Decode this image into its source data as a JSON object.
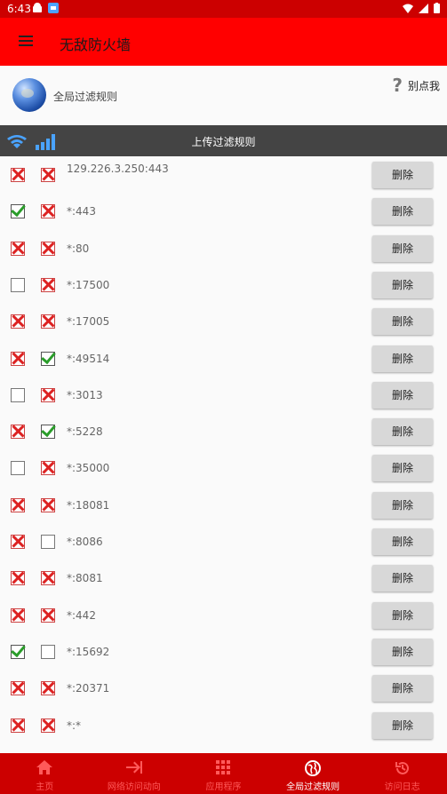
{
  "status": {
    "time": "6:43"
  },
  "app": {
    "title": "无敌防火墙"
  },
  "header": {
    "title": "全局过滤规则",
    "help_label": "别点我"
  },
  "toolbar": {
    "upload_label": "上传过滤规则"
  },
  "rules": [
    {
      "addr": "129.226.3.250:443",
      "c1": "x",
      "c2": "x"
    },
    {
      "addr": "*:443",
      "c1": "ok",
      "c2": "x"
    },
    {
      "addr": "*:80",
      "c1": "x",
      "c2": "x"
    },
    {
      "addr": "*:17500",
      "c1": "empty",
      "c2": "x"
    },
    {
      "addr": "*:17005",
      "c1": "x",
      "c2": "x"
    },
    {
      "addr": "*:49514",
      "c1": "x",
      "c2": "ok"
    },
    {
      "addr": "*:3013",
      "c1": "empty",
      "c2": "x"
    },
    {
      "addr": "*:5228",
      "c1": "x",
      "c2": "ok"
    },
    {
      "addr": "*:35000",
      "c1": "empty",
      "c2": "x"
    },
    {
      "addr": "*:18081",
      "c1": "x",
      "c2": "x"
    },
    {
      "addr": "*:8086",
      "c1": "x",
      "c2": "empty"
    },
    {
      "addr": "*:8081",
      "c1": "x",
      "c2": "x"
    },
    {
      "addr": "*:442",
      "c1": "x",
      "c2": "x"
    },
    {
      "addr": "*:15692",
      "c1": "ok",
      "c2": "empty"
    },
    {
      "addr": "*:20371",
      "c1": "x",
      "c2": "x"
    },
    {
      "addr": "*:*",
      "c1": "x",
      "c2": "x"
    }
  ],
  "delete_label": "删除",
  "tabs": [
    {
      "label": "主页",
      "icon": "home-icon",
      "active": false
    },
    {
      "label": "网络访问动向",
      "icon": "arrow-to-line-icon",
      "active": false
    },
    {
      "label": "应用程序",
      "icon": "grid-icon",
      "active": false
    },
    {
      "label": "全局过滤规则",
      "icon": "globe-icon",
      "active": true
    },
    {
      "label": "访问日志",
      "icon": "history-icon",
      "active": false
    }
  ],
  "colors": {
    "status_bar": "#cc0000",
    "app_bar": "#ff0000",
    "toolbar": "#444444",
    "bottom_nav": "#cc0000"
  }
}
